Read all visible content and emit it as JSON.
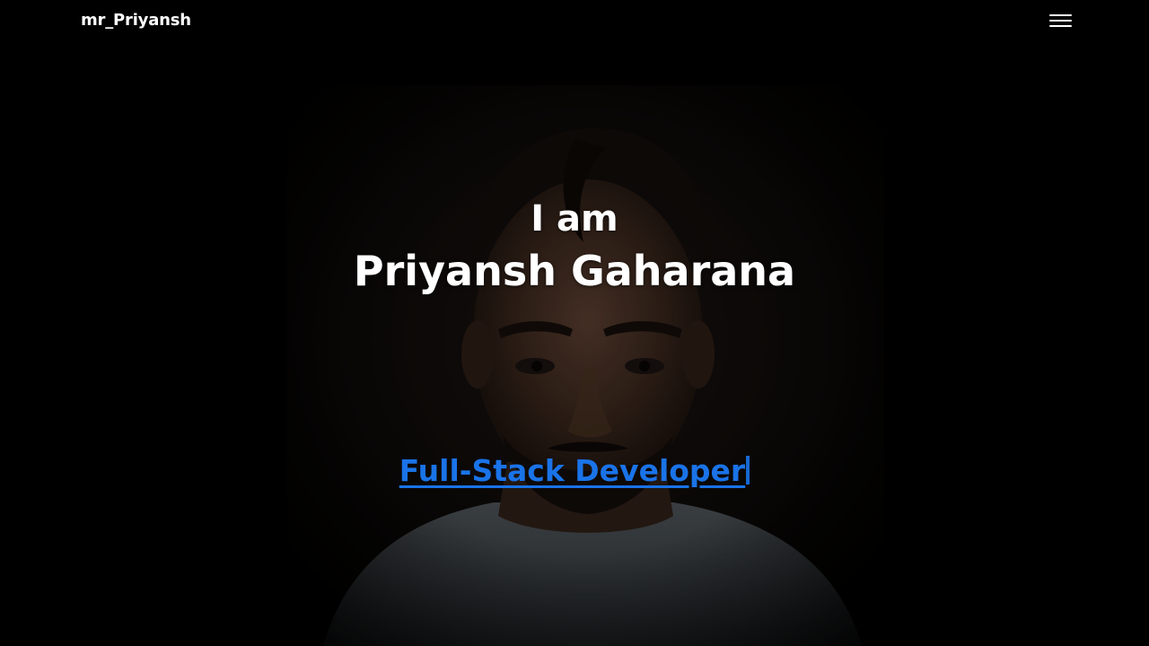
{
  "navbar": {
    "brand": "mr_Priyansh",
    "menu_icon": "hamburger-menu-icon"
  },
  "hero": {
    "intro": "I am",
    "name": "Priyansh Gaharana",
    "role": "Full-Stack Developer",
    "photo": "profile-portrait"
  },
  "colors": {
    "background": "#000000",
    "text": "#ffffff",
    "link": "#1a73e8"
  }
}
